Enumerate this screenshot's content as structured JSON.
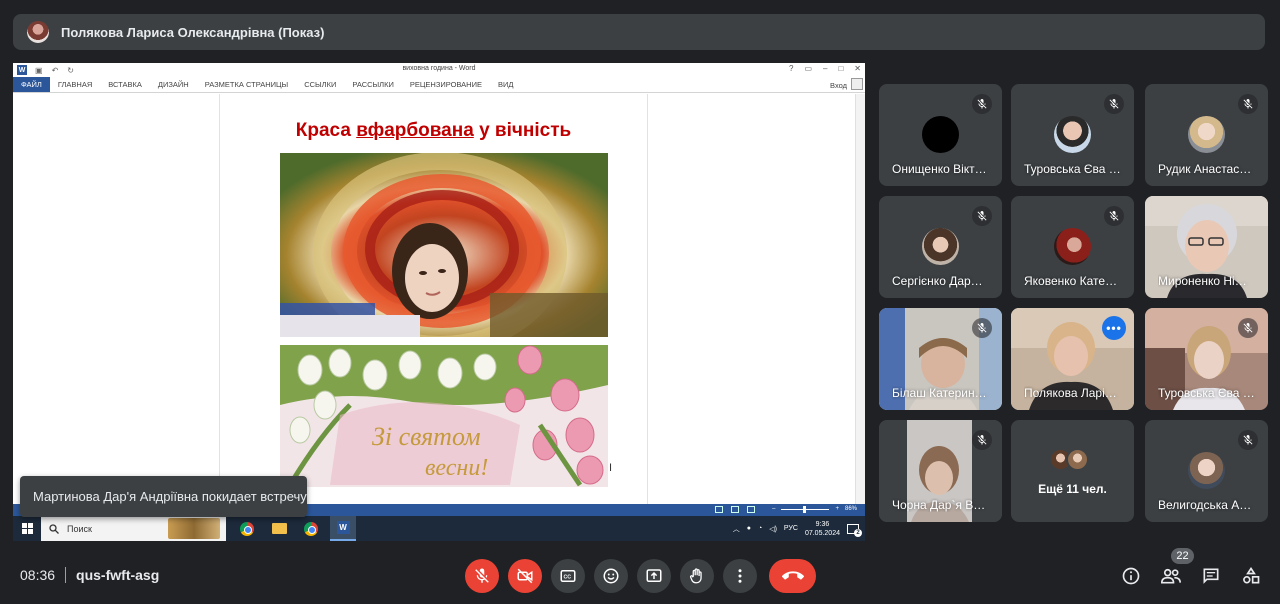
{
  "presenter": {
    "name": "Полякова Лариса Олександрівна (Показ)"
  },
  "word": {
    "doc_title": "виховна година - Word",
    "ribbon_tabs": [
      "ФАЙЛ",
      "ГЛАВНАЯ",
      "ВСТАВКА",
      "ДИЗАЙН",
      "РАЗМЕТКА СТРАНИЦЫ",
      "ССЫЛКИ",
      "РАССЫЛКИ",
      "РЕЦЕНЗИРОВАНИЕ",
      "ВИД"
    ],
    "login": "Вход",
    "heading": {
      "part1": "Краса ",
      "part2": "вфарбована",
      "part3": " у вічність"
    },
    "card_text_line1": "Зі святом",
    "card_text_line2": "весни!",
    "zoom": "86%"
  },
  "taskbar": {
    "search_placeholder": "Поиск",
    "lang": "РУС",
    "time": "9:36",
    "date": "07.05.2024",
    "notifications": "2"
  },
  "toast": {
    "text": "Мартинова Дар'я Андріївна покидает встречу"
  },
  "participants": [
    {
      "name": "Онищенко Вікт…",
      "muted": true
    },
    {
      "name": "Туровська Єва …",
      "muted": true
    },
    {
      "name": "Рудик Анастас…",
      "muted": true
    },
    {
      "name": "Сергієнко Дар…",
      "muted": true
    },
    {
      "name": "Яковенко Кате…",
      "muted": true
    },
    {
      "name": "Мироненко Ні…",
      "muted": false
    },
    {
      "name": "Білаш Катерин…",
      "muted": true
    },
    {
      "name": "Полякова Ларі…",
      "muted": false
    },
    {
      "name": "Туровська Єва …",
      "muted": true
    },
    {
      "name": "Чорна Дар`я В…",
      "muted": true
    },
    {
      "name": "Велигодська А…",
      "muted": true
    }
  ],
  "more_participants": {
    "label": "Ещё 11 чел."
  },
  "meeting": {
    "time": "08:36",
    "code": "qus-fwft-asg",
    "participant_count": "22"
  },
  "icons": {
    "mic_off": "mic-off-icon",
    "cam_off": "videocam-off-icon",
    "captions": "closed-caption-icon",
    "emoji": "emoji-icon",
    "present": "present-screen-icon",
    "hand": "raise-hand-icon",
    "more": "more-vert-icon",
    "end": "call-end-icon",
    "info": "info-icon",
    "people": "people-icon",
    "chat": "chat-icon",
    "activities": "activities-icon"
  },
  "colors": {
    "accent": "#8ab4f8",
    "danger": "#ea4335",
    "surface": "#3c4043",
    "background": "#202124",
    "word_blue": "#2b579a",
    "heading_red": "#c00000"
  }
}
